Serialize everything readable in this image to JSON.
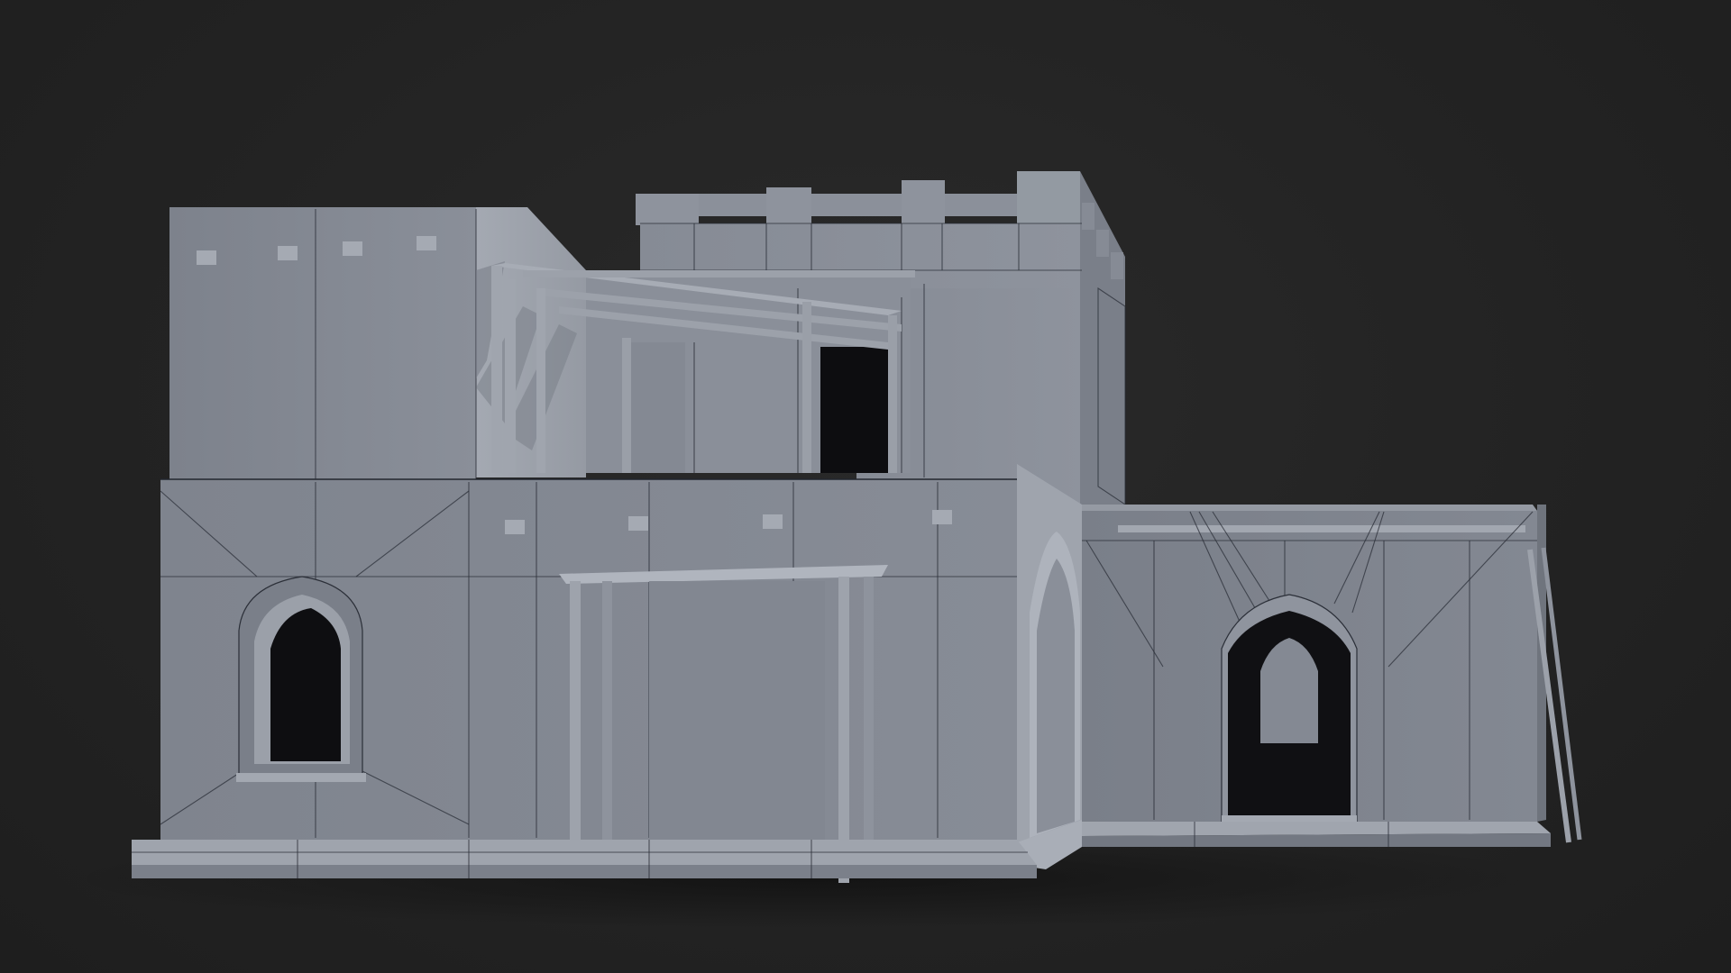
{
  "scene": {
    "background_color": "#222222",
    "wall_light": "#8d929c",
    "wall_mid": "#7e838d",
    "wall_shadow": "#6a6f78",
    "wire_color": "#2b2f38",
    "opening_color": "#0c0c0e"
  }
}
